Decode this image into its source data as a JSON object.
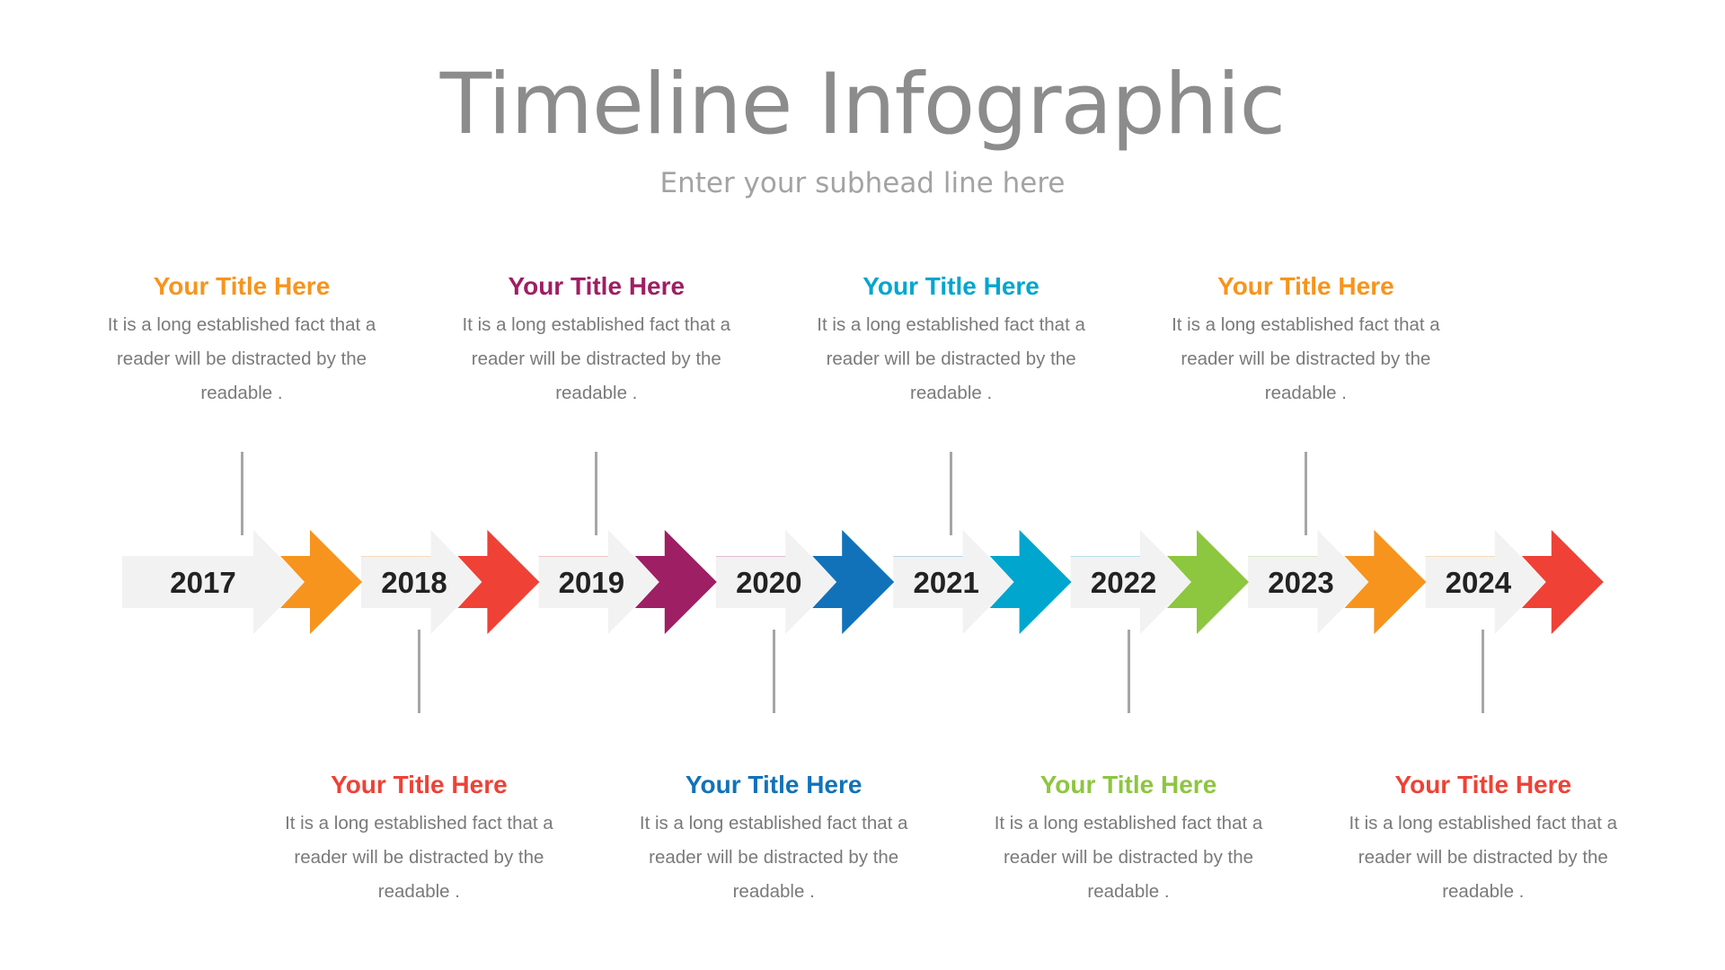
{
  "header": {
    "title": "Timeline Infographic",
    "subtitle": "Enter your subhead line here"
  },
  "colors": {
    "band": "#f2f2f2",
    "connector": "#a6a6a6",
    "title_text": "#8c8c8c",
    "subtitle_text": "#a3a3a3",
    "body_text": "#7a7a7a",
    "year_text": "#222222"
  },
  "milestones": [
    {
      "year": "2017",
      "position": "top",
      "color": "#f7941d",
      "title": "Your Title Here",
      "body_lines": [
        "It is a long established fact that a",
        "reader will be distracted by the",
        "readable ."
      ]
    },
    {
      "year": "2018",
      "position": "bottom",
      "color": "#ef4136",
      "title": "Your Title Here",
      "body_lines": [
        "It is a long established fact that a",
        "reader will be distracted by the",
        "readable ."
      ]
    },
    {
      "year": "2019",
      "position": "top",
      "color": "#9e1f63",
      "title": "Your Title Here",
      "body_lines": [
        "It is a long established fact that a",
        "reader will be distracted by the",
        "readable ."
      ]
    },
    {
      "year": "2020",
      "position": "bottom",
      "color": "#1172ba",
      "title": "Your Title Here",
      "body_lines": [
        "It is a long established fact that a",
        "reader will be distracted by the",
        "readable ."
      ]
    },
    {
      "year": "2021",
      "position": "top",
      "color": "#00a6ce",
      "title": "Your Title Here",
      "body_lines": [
        "It is a long established fact that a",
        "reader will be distracted by the",
        "readable ."
      ]
    },
    {
      "year": "2022",
      "position": "bottom",
      "color": "#8dc63f",
      "title": "Your Title Here",
      "body_lines": [
        "It is a long established fact that a",
        "reader will be distracted by the",
        "readable ."
      ]
    },
    {
      "year": "2023",
      "position": "top",
      "color": "#f7941d",
      "title": "Your Title Here",
      "body_lines": [
        "It is a long established fact that a",
        "reader will be distracted by the",
        "readable ."
      ]
    },
    {
      "year": "2024",
      "position": "bottom",
      "color": "#ef4136",
      "title": "Your Title Here",
      "body_lines": [
        "It is a long established fact that a",
        "reader will be distracted by the",
        "readable ."
      ]
    }
  ]
}
